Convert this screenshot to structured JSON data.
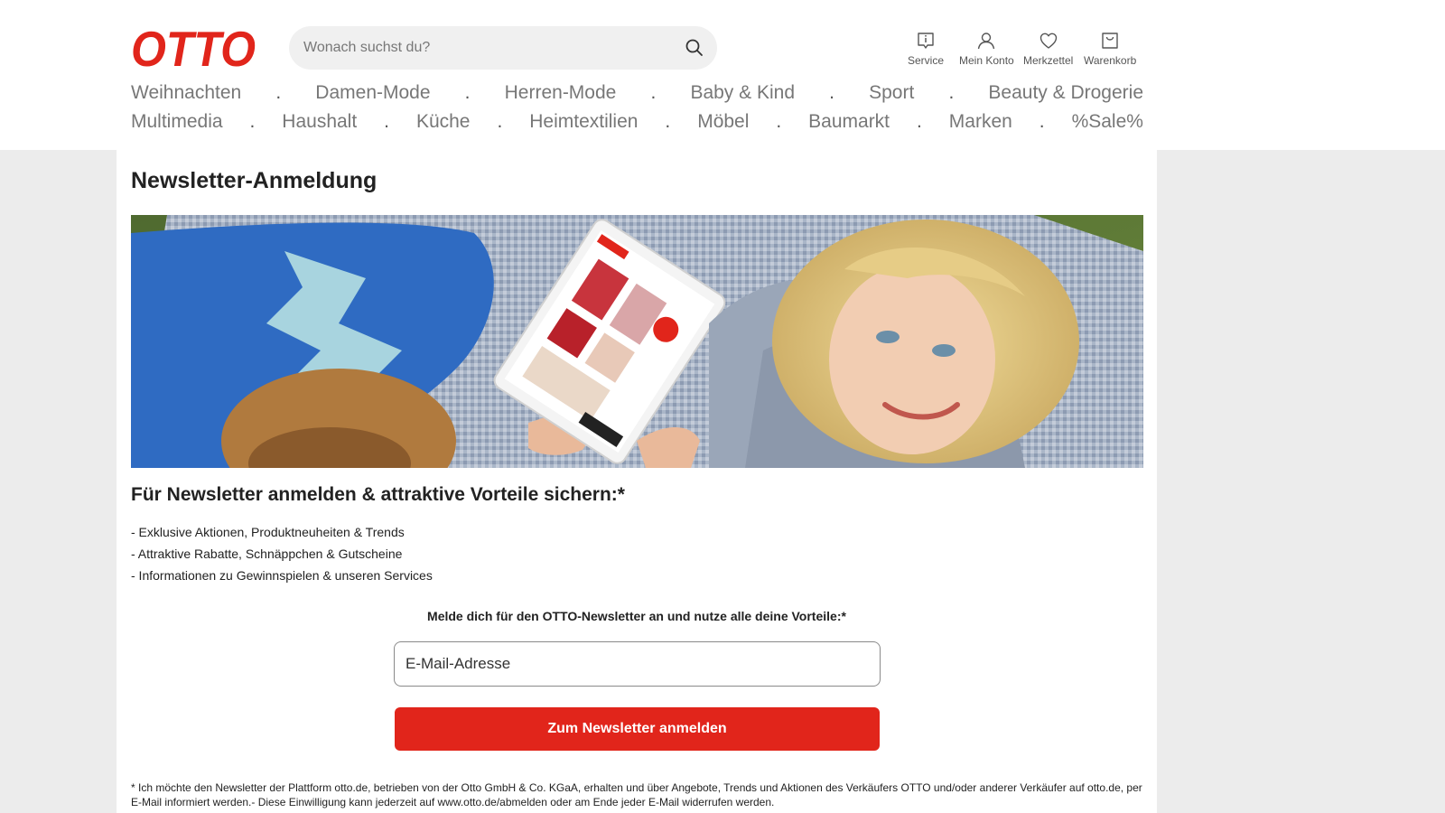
{
  "brand": {
    "logo_text": "OTTO",
    "accent_color": "#e1251b"
  },
  "search": {
    "placeholder": "Wonach suchst du?",
    "icon": "search-icon"
  },
  "header_nav": [
    {
      "label": "Service",
      "icon": "service-info-icon"
    },
    {
      "label": "Mein Konto",
      "icon": "user-icon"
    },
    {
      "label": "Merkzettel",
      "icon": "heart-icon"
    },
    {
      "label": "Warenkorb",
      "icon": "shopping-bag-icon"
    }
  ],
  "categories": {
    "row1": [
      "Weihnachten",
      "Damen-Mode",
      "Herren-Mode",
      "Baby & Kind",
      "Sport",
      "Beauty & Drogerie"
    ],
    "row2": [
      "Multimedia",
      "Haushalt",
      "Küche",
      "Heimtextilien",
      "Möbel",
      "Baumarkt",
      "Marken",
      "%Sale%"
    ],
    "separator": "."
  },
  "page": {
    "title": "Newsletter-Anmeldung",
    "benefits_title": "Für Newsletter anmelden & attraktive Vorteile sichern:*",
    "benefits": [
      "- Exklusive Aktionen, Produktneuheiten & Trends",
      "- Attraktive Rabatte, Schnäppchen & Gutscheine",
      "- Informationen zu Gewinnspielen & unseren Services"
    ],
    "form": {
      "intro": "Melde dich für den OTTO-Newsletter an und nutze alle deine Vorteile:*",
      "email_placeholder": "E-Mail-Adresse",
      "submit_label": "Zum Newsletter anmelden"
    },
    "disclaimer": "* Ich möchte den Newsletter der Plattform otto.de, betrieben von der Otto GmbH & Co. KGaA, erhalten und über Angebote, Trends und Aktionen des Verkäufers OTTO und/oder anderer Verkäufer auf otto.de, per E-Mail informiert werden.- Diese Einwilligung kann jederzeit auf www.otto.de/abmelden oder am Ende jeder E-Mail widerrufen werden."
  }
}
